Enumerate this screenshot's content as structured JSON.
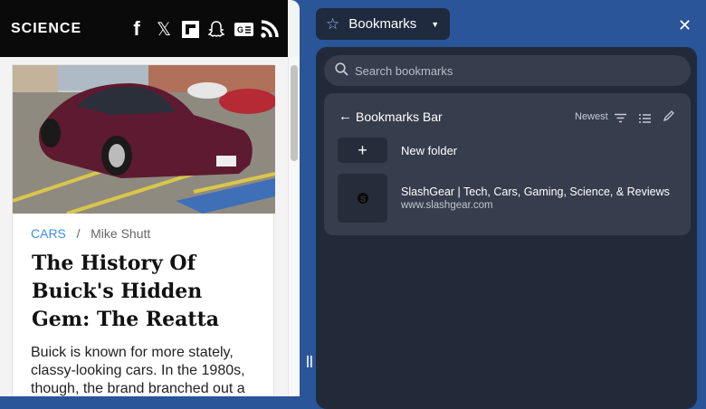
{
  "site": {
    "section": "SCIENCE",
    "social": [
      "facebook-icon",
      "x-icon",
      "flipboard-icon",
      "snapchat-icon",
      "google-news-icon",
      "rss-icon"
    ]
  },
  "article": {
    "category": "CARS",
    "separator": "/",
    "author": "Mike Shutt",
    "title": "The History Of Buick's Hidden Gem: The Reatta",
    "body": "Buick is known for more stately, classy-looking cars. In the 1980s, though, the brand branched out a"
  },
  "sidepanel": {
    "title": "Bookmarks",
    "search_placeholder": "Search bookmarks",
    "folder_title": "Bookmarks Bar",
    "sort_label": "Newest",
    "new_folder": "New folder",
    "bookmarks": [
      {
        "title": "SlashGear | Tech, Cars, Gaming, Science, & Reviews",
        "url": "www.slashgear.com"
      }
    ]
  },
  "colors": {
    "accent": "#2a5598",
    "panel": "#222a3a",
    "category": "#3a8fe0"
  }
}
